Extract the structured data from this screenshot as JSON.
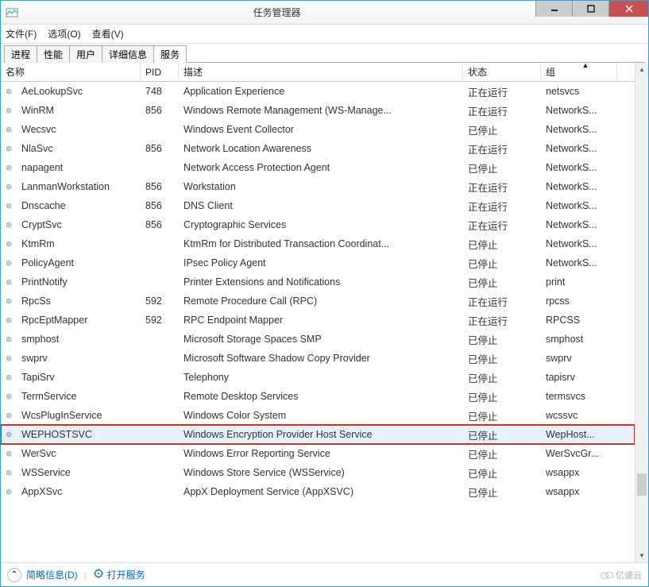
{
  "window": {
    "title": "任务管理器"
  },
  "menu": {
    "file": "文件(F)",
    "options": "选项(O)",
    "view": "查看(V)"
  },
  "tabs": {
    "proc": "进程",
    "perf": "性能",
    "users": "用户",
    "details": "详细信息",
    "services": "服务"
  },
  "columns": {
    "name": "名称",
    "pid": "PID",
    "desc": "描述",
    "status": "状态",
    "group": "组"
  },
  "rows": [
    {
      "name": "AeLookupSvc",
      "pid": "748",
      "desc": "Application Experience",
      "status": "正在运行",
      "group": "netsvcs"
    },
    {
      "name": "WinRM",
      "pid": "856",
      "desc": "Windows Remote Management (WS-Manage...",
      "status": "正在运行",
      "group": "NetworkS..."
    },
    {
      "name": "Wecsvc",
      "pid": "",
      "desc": "Windows Event Collector",
      "status": "已停止",
      "group": "NetworkS..."
    },
    {
      "name": "NlaSvc",
      "pid": "856",
      "desc": "Network Location Awareness",
      "status": "正在运行",
      "group": "NetworkS..."
    },
    {
      "name": "napagent",
      "pid": "",
      "desc": "Network Access Protection Agent",
      "status": "已停止",
      "group": "NetworkS..."
    },
    {
      "name": "LanmanWorkstation",
      "pid": "856",
      "desc": "Workstation",
      "status": "正在运行",
      "group": "NetworkS..."
    },
    {
      "name": "Dnscache",
      "pid": "856",
      "desc": "DNS Client",
      "status": "正在运行",
      "group": "NetworkS..."
    },
    {
      "name": "CryptSvc",
      "pid": "856",
      "desc": "Cryptographic Services",
      "status": "正在运行",
      "group": "NetworkS..."
    },
    {
      "name": "KtmRm",
      "pid": "",
      "desc": "KtmRm for Distributed Transaction Coordinat...",
      "status": "已停止",
      "group": "NetworkS..."
    },
    {
      "name": "PolicyAgent",
      "pid": "",
      "desc": "IPsec Policy Agent",
      "status": "已停止",
      "group": "NetworkS..."
    },
    {
      "name": "PrintNotify",
      "pid": "",
      "desc": "Printer Extensions and Notifications",
      "status": "已停止",
      "group": "print"
    },
    {
      "name": "RpcSs",
      "pid": "592",
      "desc": "Remote Procedure Call (RPC)",
      "status": "正在运行",
      "group": "rpcss"
    },
    {
      "name": "RpcEptMapper",
      "pid": "592",
      "desc": "RPC Endpoint Mapper",
      "status": "正在运行",
      "group": "RPCSS"
    },
    {
      "name": "smphost",
      "pid": "",
      "desc": "Microsoft Storage Spaces SMP",
      "status": "已停止",
      "group": "smphost"
    },
    {
      "name": "swprv",
      "pid": "",
      "desc": "Microsoft Software Shadow Copy Provider",
      "status": "已停止",
      "group": "swprv"
    },
    {
      "name": "TapiSrv",
      "pid": "",
      "desc": "Telephony",
      "status": "已停止",
      "group": "tapisrv"
    },
    {
      "name": "TermService",
      "pid": "",
      "desc": "Remote Desktop Services",
      "status": "已停止",
      "group": "termsvcs"
    },
    {
      "name": "WcsPlugInService",
      "pid": "",
      "desc": "Windows Color System",
      "status": "已停止",
      "group": "wcssvc"
    },
    {
      "name": "WEPHOSTSVC",
      "pid": "",
      "desc": "Windows Encryption Provider Host Service",
      "status": "已停止",
      "group": "WepHost...",
      "highlight": true
    },
    {
      "name": "WerSvc",
      "pid": "",
      "desc": "Windows Error Reporting Service",
      "status": "已停止",
      "group": "WerSvcGr..."
    },
    {
      "name": "WSService",
      "pid": "",
      "desc": "Windows Store Service (WSService)",
      "status": "已停止",
      "group": "wsappx"
    },
    {
      "name": "AppXSvc",
      "pid": "",
      "desc": "AppX Deployment Service (AppXSVC)",
      "status": "已停止",
      "group": "wsappx"
    }
  ],
  "statusbar": {
    "brief": "简略信息(D)",
    "open_services": "打开服务"
  },
  "watermark": "亿速云"
}
